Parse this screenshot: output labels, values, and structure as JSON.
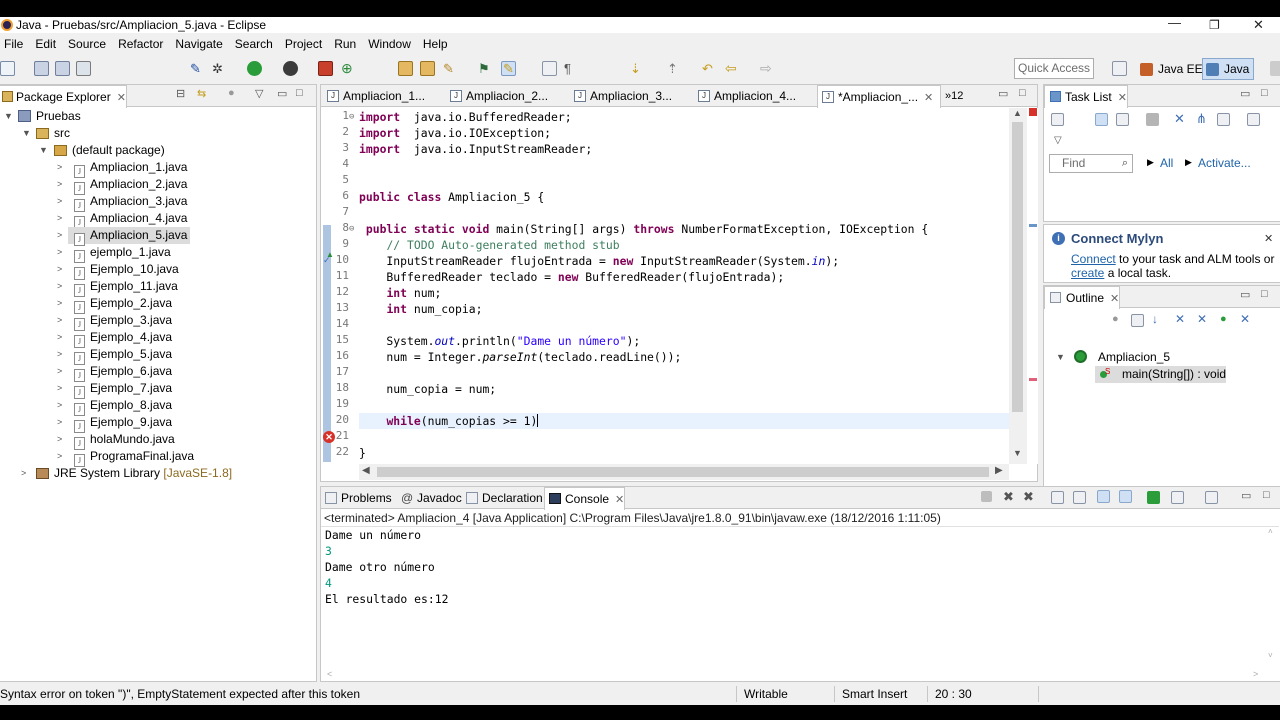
{
  "window": {
    "title": "Java - Pruebas/src/Ampliacion_5.java - Eclipse"
  },
  "menu": [
    "File",
    "Edit",
    "Source",
    "Refactor",
    "Navigate",
    "Search",
    "Project",
    "Run",
    "Window",
    "Help"
  ],
  "toolbar": {
    "quick_access": "Quick Access",
    "perspective_java_ee": "Java EE",
    "perspective_java": "Java"
  },
  "package_explorer": {
    "title": "Package Explorer",
    "project": "Pruebas",
    "src": "src",
    "package": "(default package)",
    "files": [
      "Ampliacion_1.java",
      "Ampliacion_2.java",
      "Ampliacion_3.java",
      "Ampliacion_4.java",
      "Ampliacion_5.java",
      "ejemplo_1.java",
      "Ejemplo_10.java",
      "Ejemplo_11.java",
      "Ejemplo_2.java",
      "Ejemplo_3.java",
      "Ejemplo_4.java",
      "Ejemplo_5.java",
      "Ejemplo_6.java",
      "Ejemplo_7.java",
      "Ejemplo_8.java",
      "Ejemplo_9.java",
      "holaMundo.java",
      "ProgramaFinal.java"
    ],
    "selected_file": "Ampliacion_5.java",
    "library": "JRE System Library",
    "library_version": "[JavaSE-1.8]"
  },
  "editor": {
    "tabs": [
      "Ampliacion_1...",
      "Ampliacion_2...",
      "Ampliacion_3...",
      "Ampliacion_4...",
      "*Ampliacion_..."
    ],
    "overflow": "»12",
    "line_numbers": [
      "1",
      "2",
      "3",
      "4",
      "5",
      "6",
      "7",
      "8",
      "9",
      "10",
      "11",
      "12",
      "13",
      "14",
      "15",
      "16",
      "17",
      "18",
      "19",
      "20",
      "21",
      "22"
    ]
  },
  "task_list": {
    "title": "Task List",
    "find_placeholder": "Find",
    "all": "All",
    "activate": "Activate..."
  },
  "mylyn": {
    "title": "Connect Mylyn",
    "connect": "Connect",
    "text1": " to your task and ALM tools or",
    "create": "create",
    "text2": " a local task."
  },
  "outline": {
    "title": "Outline",
    "class": "Ampliacion_5",
    "method": "main(String[]) : void"
  },
  "bottom_tabs": [
    "Problems",
    "Javadoc",
    "Declaration",
    "Console"
  ],
  "console": {
    "header": "<terminated> Ampliacion_4 [Java Application] C:\\Program Files\\Java\\jre1.8.0_91\\bin\\javaw.exe (18/12/2016 1:11:05)",
    "lines": [
      {
        "text": "Dame un número",
        "color": "#000000"
      },
      {
        "text": "3",
        "color": "#009a7a"
      },
      {
        "text": "Dame otro número",
        "color": "#000000"
      },
      {
        "text": "4",
        "color": "#009a7a"
      },
      {
        "text": "El resultado es:12",
        "color": "#000000"
      }
    ]
  },
  "status": {
    "message": "Syntax error on token \")\", EmptyStatement expected after this token",
    "writable": "Writable",
    "insert_mode": "Smart Insert",
    "position": "20 : 30"
  }
}
